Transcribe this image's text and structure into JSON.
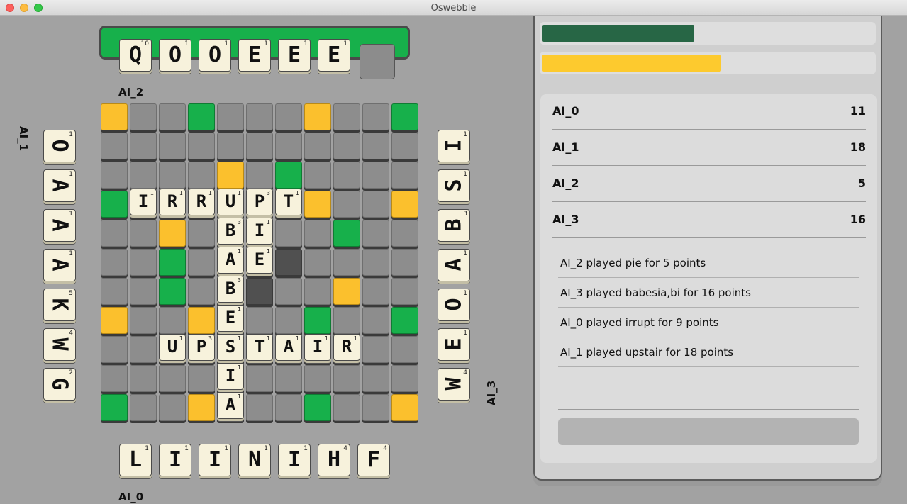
{
  "window": {
    "title": "Oswebble"
  },
  "board": {
    "size": 11,
    "premium_yellow": [
      [
        0,
        0
      ],
      [
        0,
        7
      ],
      [
        2,
        4
      ],
      [
        3,
        7
      ],
      [
        3,
        10
      ],
      [
        4,
        2
      ],
      [
        6,
        8
      ],
      [
        7,
        0
      ],
      [
        7,
        3
      ],
      [
        10,
        3
      ],
      [
        10,
        10
      ]
    ],
    "premium_green": [
      [
        0,
        3
      ],
      [
        0,
        10
      ],
      [
        2,
        6
      ],
      [
        3,
        0
      ],
      [
        4,
        8
      ],
      [
        5,
        2
      ],
      [
        6,
        2
      ],
      [
        7,
        7
      ],
      [
        7,
        10
      ],
      [
        10,
        0
      ],
      [
        10,
        7
      ]
    ],
    "dark_cells": [
      [
        5,
        6
      ],
      [
        6,
        5
      ]
    ],
    "tiles": [
      {
        "r": 3,
        "c": 1,
        "l": "I",
        "p": "1"
      },
      {
        "r": 3,
        "c": 2,
        "l": "R",
        "p": "1"
      },
      {
        "r": 3,
        "c": 3,
        "l": "R",
        "p": "1"
      },
      {
        "r": 3,
        "c": 4,
        "l": "U",
        "p": "1"
      },
      {
        "r": 3,
        "c": 5,
        "l": "P",
        "p": "3"
      },
      {
        "r": 3,
        "c": 6,
        "l": "T",
        "p": "1"
      },
      {
        "r": 4,
        "c": 4,
        "l": "B",
        "p": "3"
      },
      {
        "r": 4,
        "c": 5,
        "l": "I",
        "p": "1"
      },
      {
        "r": 5,
        "c": 4,
        "l": "A",
        "p": "1"
      },
      {
        "r": 5,
        "c": 5,
        "l": "E",
        "p": "1"
      },
      {
        "r": 6,
        "c": 4,
        "l": "B",
        "p": "3"
      },
      {
        "r": 7,
        "c": 4,
        "l": "E",
        "p": "1"
      },
      {
        "r": 8,
        "c": 2,
        "l": "U",
        "p": "1"
      },
      {
        "r": 8,
        "c": 3,
        "l": "P",
        "p": "3"
      },
      {
        "r": 8,
        "c": 4,
        "l": "S",
        "p": "1"
      },
      {
        "r": 8,
        "c": 5,
        "l": "T",
        "p": "1"
      },
      {
        "r": 8,
        "c": 6,
        "l": "A",
        "p": "1"
      },
      {
        "r": 8,
        "c": 7,
        "l": "I",
        "p": "1"
      },
      {
        "r": 8,
        "c": 8,
        "l": "R",
        "p": "1"
      },
      {
        "r": 9,
        "c": 4,
        "l": "I",
        "p": "1"
      },
      {
        "r": 10,
        "c": 4,
        "l": "A",
        "p": "1"
      }
    ]
  },
  "racks": {
    "top": {
      "player": "AI_2",
      "tiles": [
        {
          "l": "Q",
          "p": "10"
        },
        {
          "l": "O",
          "p": "1"
        },
        {
          "l": "O",
          "p": "1"
        },
        {
          "l": "E",
          "p": "1"
        },
        {
          "l": "E",
          "p": "1"
        },
        {
          "l": "E",
          "p": "1"
        }
      ]
    },
    "left": {
      "player": "AI_1",
      "tiles": [
        {
          "l": "O",
          "p": "1"
        },
        {
          "l": "A",
          "p": "1"
        },
        {
          "l": "A",
          "p": "1"
        },
        {
          "l": "A",
          "p": "1"
        },
        {
          "l": "K",
          "p": "5"
        },
        {
          "l": "W",
          "p": "4"
        },
        {
          "l": "G",
          "p": "2"
        }
      ]
    },
    "right": {
      "player": "AI_3",
      "tiles": [
        {
          "l": "I",
          "p": "1"
        },
        {
          "l": "S",
          "p": "1"
        },
        {
          "l": "B",
          "p": "3"
        },
        {
          "l": "A",
          "p": "1"
        },
        {
          "l": "O",
          "p": "1"
        },
        {
          "l": "E",
          "p": "1"
        },
        {
          "l": "W",
          "p": "4"
        }
      ]
    },
    "bottom": {
      "player": "AI_0",
      "tiles": [
        {
          "l": "L",
          "p": "1"
        },
        {
          "l": "I",
          "p": "1"
        },
        {
          "l": "I",
          "p": "1"
        },
        {
          "l": "N",
          "p": "1"
        },
        {
          "l": "I",
          "p": "1"
        },
        {
          "l": "H",
          "p": "4"
        },
        {
          "l": "F",
          "p": "4"
        }
      ]
    }
  },
  "progress": {
    "green_fraction": 0.46,
    "yellow_fraction": 0.54,
    "green_color": "#276645",
    "yellow_color": "#fdca2e"
  },
  "scores": [
    {
      "name": "AI_0",
      "score": "11"
    },
    {
      "name": "AI_1",
      "score": "18"
    },
    {
      "name": "AI_2",
      "score": "5"
    },
    {
      "name": "AI_3",
      "score": "16"
    }
  ],
  "log": [
    "AI_2 played pie for 5 points",
    "AI_3 played babesia,bi for 16 points",
    "AI_0 played irrupt for 9 points",
    "AI_1 played upstair for 18 points"
  ]
}
